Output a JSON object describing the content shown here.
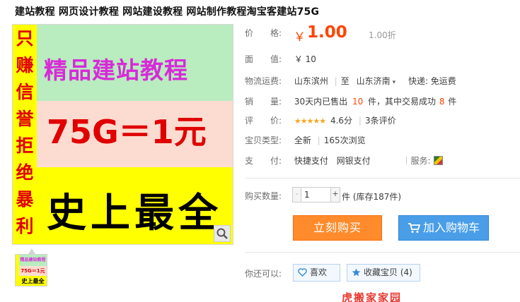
{
  "title": "建站教程 网页设计教程 网站建设教程 网站制作教程淘宝客建站75G",
  "image": {
    "left_column": [
      "只",
      "赚",
      "信",
      "誉",
      "拒",
      "绝",
      "暴",
      "利"
    ],
    "band1": "精品建站教程",
    "band2": "75G＝1元",
    "band3": "史上最全",
    "thumb": {
      "line1": "精品建站教程",
      "line2": "75G＝1元",
      "line3": "史上最全"
    }
  },
  "price": {
    "label": "价　　格:",
    "currency": "￥",
    "value": "1.00",
    "discount": "1.00折"
  },
  "face": {
    "label": "面　　值:",
    "value": "￥ 10"
  },
  "shipping": {
    "label": "物流运费:",
    "from": "山东滨州",
    "to_prefix": "至",
    "to": "山东济南",
    "express": "快递: 免运费"
  },
  "sales": {
    "label": "销　　量:",
    "prefix": "30天内已售出",
    "sold": "10",
    "middle": "件，其中交易成功",
    "success": "8",
    "suffix": "件"
  },
  "rating": {
    "label": "评　　价:",
    "stars": "★★★★★",
    "score": "4.6分",
    "reviews": "3条评价"
  },
  "type": {
    "label": "宝贝类型:",
    "value": "全新",
    "views": "165次浏览"
  },
  "payment": {
    "label": "支　　付:",
    "method1": "快捷支付",
    "method2": "网银支付",
    "service_label": "服务:"
  },
  "purchase": {
    "label": "购买数量:",
    "minus": "-",
    "quantity": "1",
    "plus": "+",
    "stock": "件 (库存187件)"
  },
  "buttons": {
    "buy_now": "立刻购买",
    "add_cart": "加入购物车",
    "like": "喜欢",
    "favorite": "收藏宝贝 (4)"
  },
  "also_can": "你还可以:",
  "bottom_cut_text": "虎搬家家园",
  "colors": {
    "accent": "#ff4400",
    "buy": "#ff8b2c",
    "cart": "#4a9ee8",
    "star": "#f5a623"
  }
}
